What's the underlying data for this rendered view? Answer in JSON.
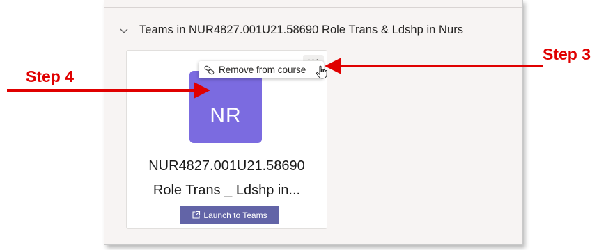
{
  "section": {
    "title": "Teams in NUR4827.001U21.58690 Role Trans & Ldshp in Nurs",
    "chevron_icon": "chevron-down-icon"
  },
  "team_card": {
    "more_options_label": "···",
    "avatar_initials": "NR",
    "avatar_color": "#7b6be0",
    "name_line1": "NUR4827.001U21.58690",
    "name_line2": "Role Trans _ Ldshp in...",
    "launch_button_label": "Launch to Teams",
    "launch_icon": "external-link-icon",
    "launch_button_color": "#6264a7"
  },
  "context_menu": {
    "items": [
      {
        "label": "Remove from course",
        "icon": "unlink-icon"
      }
    ]
  },
  "annotations": {
    "step3": "Step 3",
    "step4": "Step 4",
    "color": "#e00000"
  }
}
